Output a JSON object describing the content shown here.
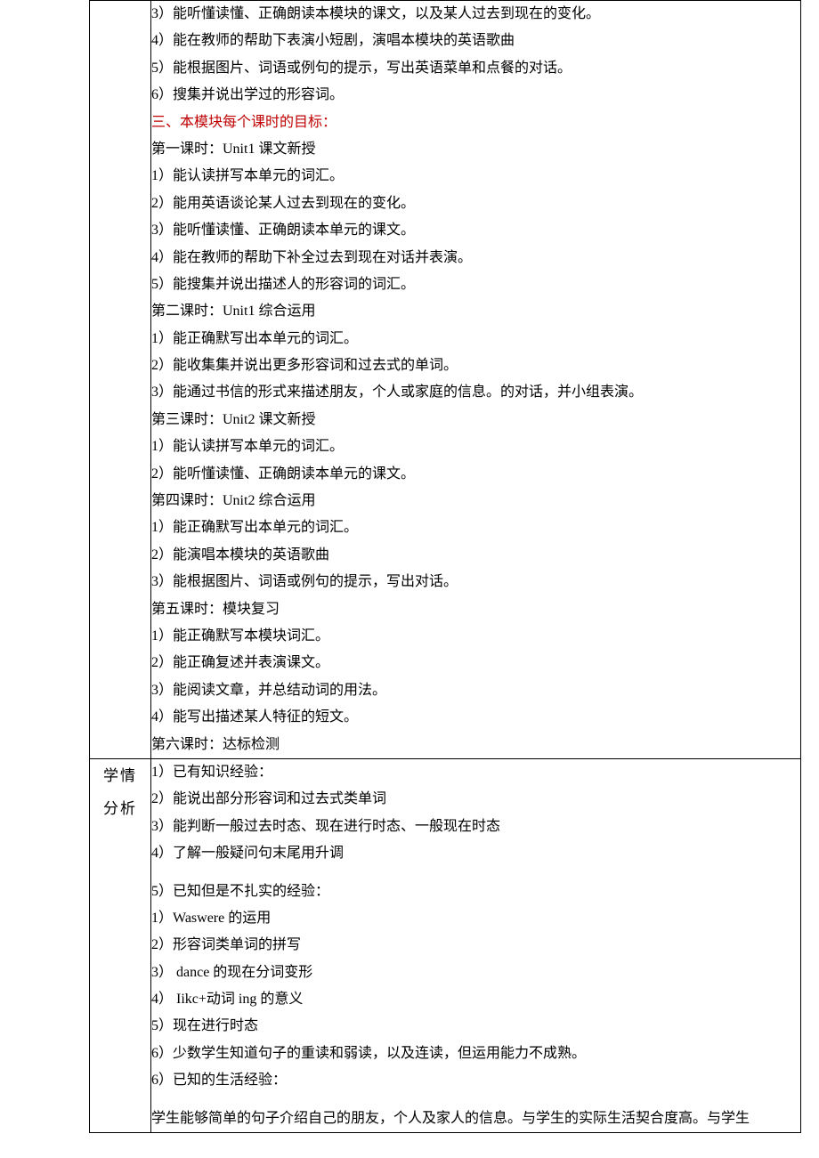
{
  "section1": {
    "lines": [
      "3）能听懂读懂、正确朗读本模块的课文，以及某人过去到现在的变化。",
      "4）能在教师的帮助下表演小短剧，演唱本模块的英语歌曲",
      "5）能根据图片、词语或例句的提示，写出英语菜单和点餐的对话。",
      "6）搜集并说出学过的形容词。"
    ],
    "heading": "三、本模块每个课时的目标：",
    "lesson1_title": "第一课时：Unit1 课文新授",
    "lesson1": [
      "1）能认读拼写本单元的词汇。",
      "2）能用英语谈论某人过去到现在的变化。",
      "3）能听懂读懂、正确朗读本单元的课文。",
      "4）能在教师的帮助下补全过去到现在对话并表演。",
      "5）能搜集并说出描述人的形容词的词汇。"
    ],
    "lesson2_title": "第二课时：Unit1 综合运用",
    "lesson2": [
      "1）能正确默写出本单元的词汇。",
      "2）能收集集并说出更多形容词和过去式的单词。",
      "3）能通过书信的形式来描述朋友，个人或家庭的信息。的对话，并小组表演。"
    ],
    "lesson3_title": "第三课时：Unit2 课文新授",
    "lesson3": [
      "1）能认读拼写本单元的词汇。",
      "2）能听懂读懂、正确朗读本单元的课文。"
    ],
    "lesson4_title": "第四课时：Unit2 综合运用",
    "lesson4": [
      "1）能正确默写出本单元的词汇。",
      "2）能演唱本模块的英语歌曲",
      "3）能根据图片、词语或例句的提示，写出对话。"
    ],
    "lesson5_title": "第五课时：模块复习",
    "lesson5": [
      "1）能正确默写本模块词汇。",
      "2）能正确复述并表演课文。",
      "3）能阅读文章，并总结动词的用法。",
      "4）能写出描述某人特征的短文。"
    ],
    "lesson6_title": "第六课时：达标检测"
  },
  "section2": {
    "label_line1": "学情",
    "label_line2": "分析",
    "lines_a": [
      "1）已有知识经验：",
      "2）能说出部分形容词和过去式类单词",
      "3）能判断一般过去时态、现在进行时态、一般现在时态",
      "4）了解一般疑问句末尾用升调"
    ],
    "lines_b": [
      "5）已知但是不扎实的经验：",
      "1）Waswere 的运用",
      "2）形容词类单词的拼写",
      "3） dance 的现在分词变形",
      "4） Iikc+动词 ing 的意义",
      "5）现在进行时态",
      "6）少数学生知道句子的重读和弱读，以及连读，但运用能力不成熟。",
      "6）已知的生活经验："
    ],
    "tail": "学生能够简单的句子介绍自己的朋友，个人及家人的信息。与学生的实际生活契合度高。与学生"
  }
}
